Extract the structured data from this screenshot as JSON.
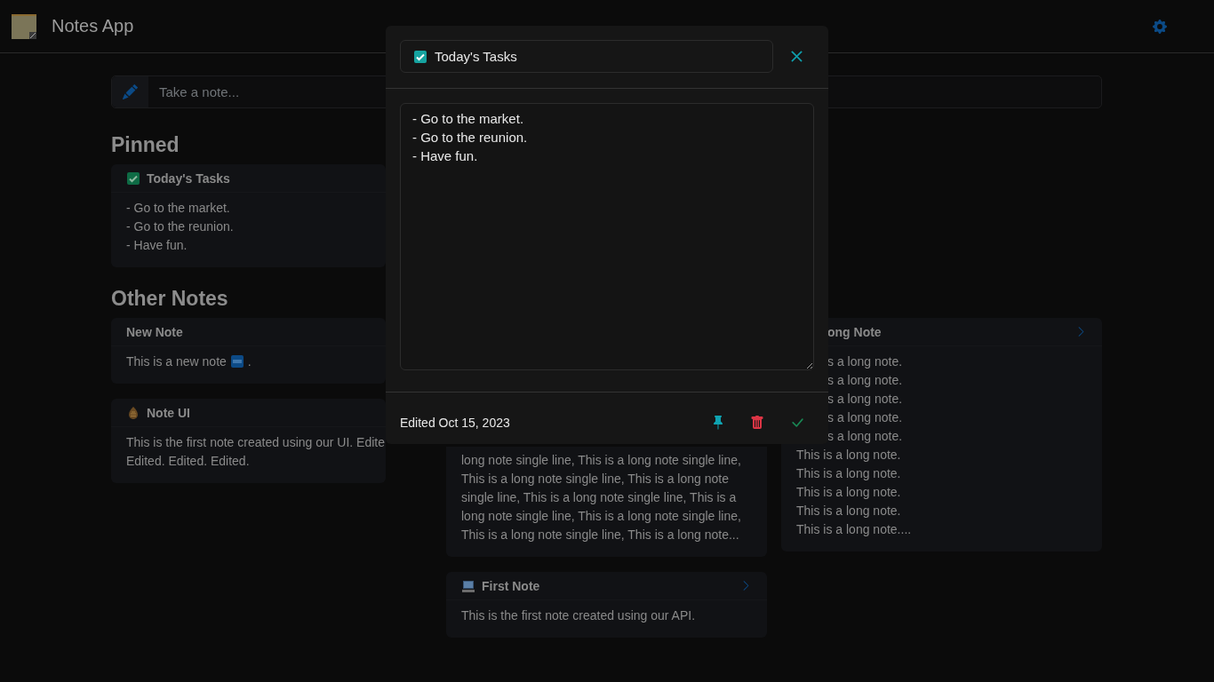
{
  "header": {
    "title": "Notes App"
  },
  "composer": {
    "placeholder": "Take a note..."
  },
  "sections": [
    {
      "title": "Pinned",
      "columns": [
        [
          {
            "kind": "checklist",
            "title": "Today's Tasks",
            "expandable": false,
            "lines": [
              {
                "text": "- Go to the market."
              },
              {
                "text": "- Go to the reunion."
              },
              {
                "text": "- Have fun."
              }
            ]
          }
        ]
      ]
    },
    {
      "title": "Other Notes",
      "columns": [
        [
          {
            "kind": "plain",
            "title": "New Note",
            "expandable": false,
            "lines": [
              {
                "text": "This is a new note",
                "kind": "badge",
                "suffix": "."
              }
            ]
          },
          {
            "kind": "idea",
            "title": "Note UI",
            "expandable": false,
            "lines": [
              {
                "text": "This is the first note created using our UI. Edite"
              },
              {
                "text": "Edited. Edited. Edited."
              }
            ]
          }
        ],
        [
          {
            "kind": "covered",
            "lines": [
              {
                "text": "long note single line, This is a long note single line,"
              },
              {
                "text": "This is a long note single line, This is a long note"
              },
              {
                "text": "single line, This is a long note single line, This is a"
              },
              {
                "text": "long note single line, This is a long note single line,"
              },
              {
                "text": "This is a long note single line, This is a long note..."
              }
            ]
          },
          {
            "kind": "computer",
            "title": "First Note",
            "expandable": true,
            "lines": [
              {
                "text": "This is the first note created using our API."
              }
            ]
          }
        ],
        [
          {
            "kind": "cut",
            "title": "ong Note",
            "expandable": true,
            "lines": [
              {
                "text": "s a long note.",
                "kind": "cut"
              },
              {
                "text": "s a long note.",
                "kind": "cut"
              },
              {
                "text": "s a long note.",
                "kind": "cut"
              },
              {
                "text": "s a long note.",
                "kind": "cut"
              },
              {
                "text": "s a long note.",
                "kind": "cut"
              },
              {
                "text": "This is a long note."
              },
              {
                "text": "This is a long note."
              },
              {
                "text": "This is a long note."
              },
              {
                "text": "This is a long note."
              },
              {
                "text": "This is a long note...."
              }
            ]
          }
        ]
      ]
    }
  ],
  "editor": {
    "title": "Today's Tasks",
    "body": "- Go to the market.\n- Go to the reunion.\n- Have fun.",
    "edited": "Edited Oct 15, 2023",
    "pinned": true
  }
}
